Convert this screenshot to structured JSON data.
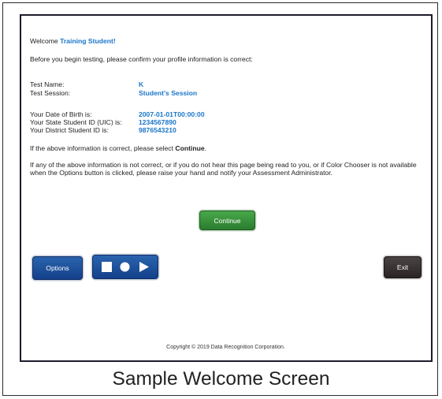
{
  "welcome": {
    "prefix": "Welcome",
    "name": "Training Student!"
  },
  "intro": "Before you begin testing, please confirm your profile information is correct:",
  "profile": {
    "test_name_label": "Test Name:",
    "test_name_value": "K",
    "test_session_label": "Test Session:",
    "test_session_value": "Student's Session",
    "dob_label": "Your Date of Birth is:",
    "dob_value": "2007-01-01T00:00:00",
    "state_id_label": "Your State Student ID (UIC) is:",
    "state_id_value": "1234567890",
    "district_id_label": "Your District Student ID is:",
    "district_id_value": "9876543210"
  },
  "confirm": {
    "prefix": "If the above information is correct, please select ",
    "keyword": "Continue",
    "suffix": "."
  },
  "notice": "If any of the above information is not correct, or if you do not hear this page being read to you, or if Color Chooser is not available when the Options button is clicked, please raise your hand and notify your Assessment Administrator.",
  "buttons": {
    "continue": "Continue",
    "options": "Options",
    "exit": "Exit"
  },
  "media": {
    "stop_icon": "stop-icon",
    "record_icon": "record-icon",
    "play_icon": "play-icon"
  },
  "copyright": "Copyright © 2019 Data Recognition Corporation.",
  "caption": "Sample Welcome Screen",
  "colors": {
    "accent_blue": "#1a76c8",
    "continue_green": "#2f8b33",
    "options_blue": "#1c4f9c",
    "exit_dark": "#332c2c"
  }
}
